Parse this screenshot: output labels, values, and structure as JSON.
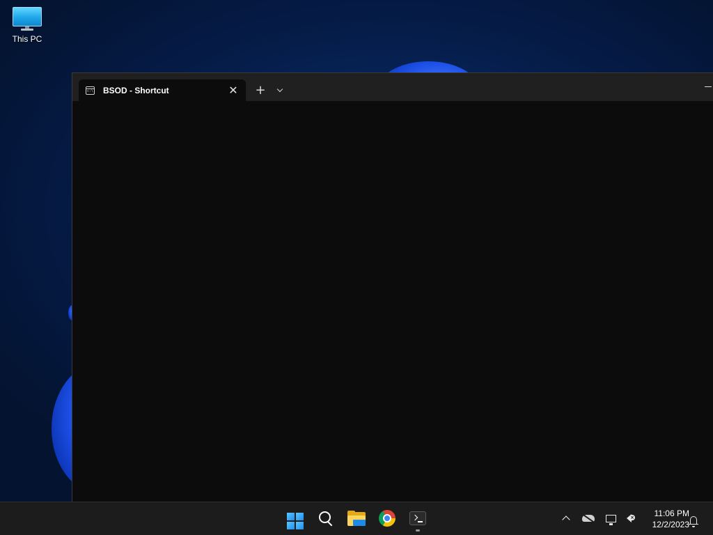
{
  "desktop": {
    "icons": [
      {
        "label": "This PC",
        "icon": "monitor-icon"
      }
    ]
  },
  "window": {
    "tabs": [
      {
        "title": "BSOD - Shortcut",
        "icon": "cmd-icon",
        "close_glyph": "✕"
      }
    ],
    "new_tab_glyph": "+",
    "dropdown_icon": "chevron-down-icon"
  },
  "taskbar": {
    "apps": [
      {
        "name": "Start",
        "icon": "windows-logo-icon"
      },
      {
        "name": "Search",
        "icon": "search-icon"
      },
      {
        "name": "File Explorer",
        "icon": "folder-icon"
      },
      {
        "name": "Google Chrome",
        "icon": "chrome-icon"
      },
      {
        "name": "Terminal",
        "icon": "terminal-icon",
        "running": true
      }
    ],
    "tray": {
      "time": "11:06 PM",
      "date": "12/2/2023",
      "icons": [
        "chevron-up-icon",
        "cloud-off-icon",
        "network-icon",
        "volume-muted-icon",
        "notification-bell-icon"
      ]
    }
  },
  "colors": {
    "terminal_bg": "#0c0c0c",
    "titlebar_bg": "#202020",
    "taskbar_bg": "#1c1c1c",
    "wallpaper_accent": "#1c4fe6"
  }
}
